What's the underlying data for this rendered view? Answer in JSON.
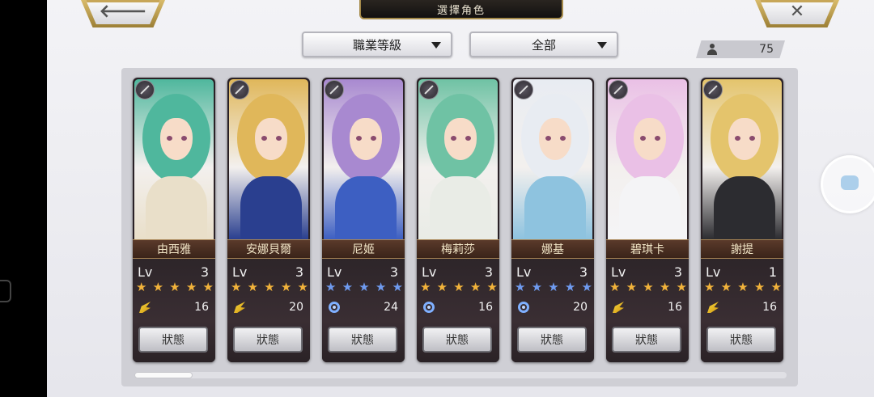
{
  "title": "選擇角色",
  "nav": {
    "back_icon": "arrow-left-icon",
    "back_glyph": "🡐",
    "close_icon": "close-icon",
    "close_glyph": "✕"
  },
  "filters": {
    "sort_label": "職業等級",
    "category_label": "全部"
  },
  "unit_count": "75",
  "status_label": "狀態",
  "colors": {
    "gold_star": "#f2b33b",
    "blue_star": "#6f9bf0",
    "accent_gold": "#c7a658"
  },
  "characters": [
    {
      "name": "由西雅",
      "lv_label": "Lv",
      "level": "3",
      "stars": "★★★★★",
      "star_color": "gold",
      "cost_icon": "wing-icon",
      "cost": "16",
      "hair": "#4fb79d",
      "outfit": "#e9dfc9"
    },
    {
      "name": "安娜貝爾",
      "lv_label": "Lv",
      "level": "3",
      "stars": "★★★★★",
      "star_color": "gold",
      "cost_icon": "wing-icon",
      "cost": "20",
      "hair": "#e0b75a",
      "outfit": "#2a3f8f"
    },
    {
      "name": "尼姬",
      "lv_label": "Lv",
      "level": "3",
      "stars": "★★★★★",
      "star_color": "blue",
      "cost_icon": "swirl-icon",
      "cost": "24",
      "hair": "#a889d0",
      "outfit": "#3d5fc2"
    },
    {
      "name": "梅莉莎",
      "lv_label": "Lv",
      "level": "3",
      "stars": "★★★★★",
      "star_color": "gold",
      "cost_icon": "swirl-icon",
      "cost": "16",
      "hair": "#6fc2a4",
      "outfit": "#e9ece6"
    },
    {
      "name": "娜基",
      "lv_label": "Lv",
      "level": "3",
      "stars": "★★★★★",
      "star_color": "blue",
      "cost_icon": "swirl-icon",
      "cost": "20",
      "hair": "#e8ecf2",
      "outfit": "#8ec3df"
    },
    {
      "name": "碧琪卡",
      "lv_label": "Lv",
      "level": "3",
      "stars": "★★★★★",
      "star_color": "gold",
      "cost_icon": "wing-icon",
      "cost": "16",
      "hair": "#eac0e6",
      "outfit": "#f4f4f6"
    },
    {
      "name": "謝提",
      "lv_label": "Lv",
      "level": "1",
      "stars": "★★★★★",
      "star_color": "gold",
      "cost_icon": "wing-icon",
      "cost": "16",
      "hair": "#e4c46c",
      "outfit": "#2c2c30"
    }
  ]
}
